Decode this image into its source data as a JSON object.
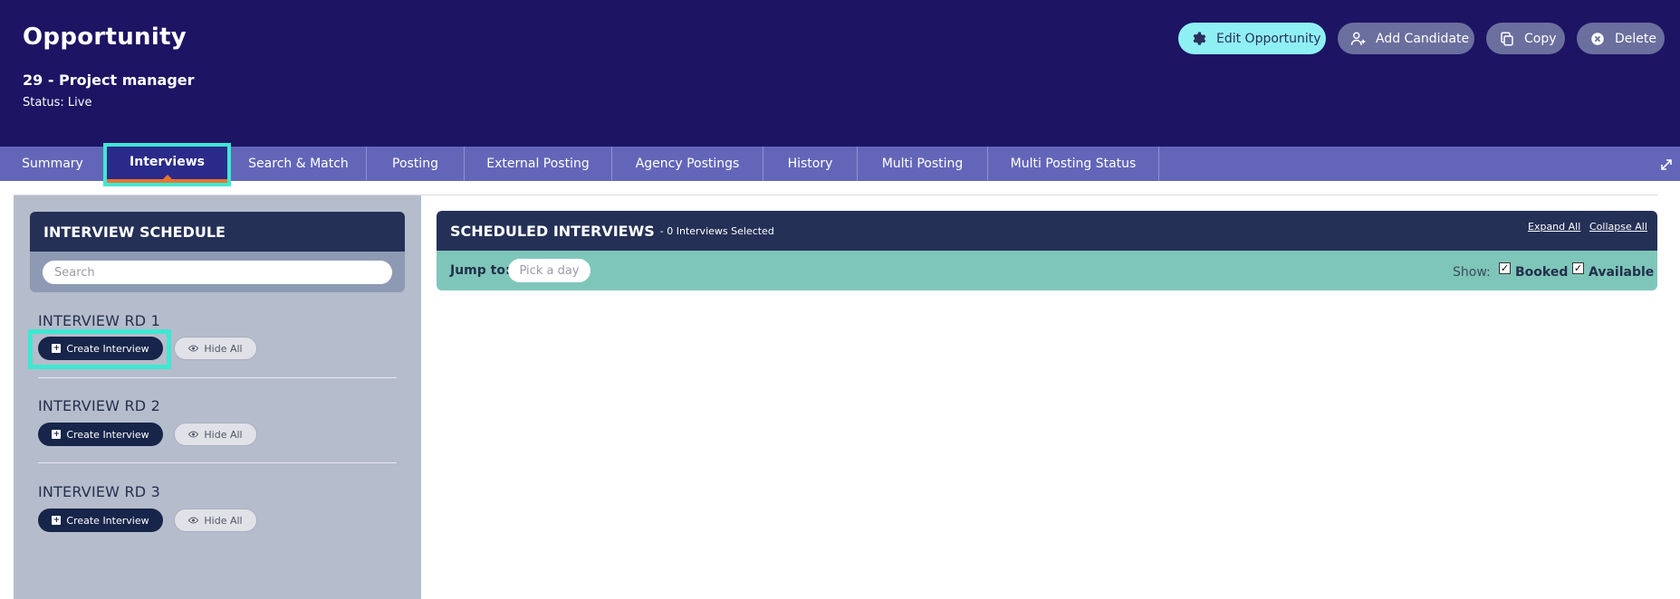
{
  "header": {
    "title": "Opportunity",
    "subtitle": "29 - Project manager",
    "status": "Status: Live",
    "buttons": {
      "edit": "Edit Opportunity",
      "add_candidate": "Add Candidate",
      "copy": "Copy",
      "delete": "Delete"
    }
  },
  "tabs": [
    {
      "label": "Summary"
    },
    {
      "label": "Interviews",
      "active": true
    },
    {
      "label": "Search & Match"
    },
    {
      "label": "Posting"
    },
    {
      "label": "External Posting"
    },
    {
      "label": "Agency Postings"
    },
    {
      "label": "History"
    },
    {
      "label": "Multi Posting"
    },
    {
      "label": "Multi Posting Status"
    }
  ],
  "schedule": {
    "title": "INTERVIEW SCHEDULE",
    "search_placeholder": "Search",
    "rounds": [
      {
        "title": "INTERVIEW RD 1",
        "create_label": "Create Interview",
        "hide_label": "Hide All"
      },
      {
        "title": "INTERVIEW RD 2",
        "create_label": "Create Interview",
        "hide_label": "Hide All"
      },
      {
        "title": "INTERVIEW RD 3",
        "create_label": "Create Interview",
        "hide_label": "Hide All"
      }
    ]
  },
  "scheduled": {
    "title": "SCHEDULED INTERVIEWS",
    "selected_text": "- 0 Interviews Selected",
    "expand_all": "Expand All",
    "collapse_all": "Collapse All",
    "jump_label": "Jump to:",
    "jump_placeholder": "Pick a day",
    "show_label": "Show:",
    "filters": [
      {
        "label": "Booked",
        "checked": true
      },
      {
        "label": "Available",
        "checked": true
      }
    ]
  },
  "colors": {
    "header_bg": "#1d1464",
    "tab_bg": "#6366b8",
    "active_tab_bg": "#2a2a8a",
    "highlight": "#3ee8d2",
    "active_underline": "#e8742d",
    "panel_dark": "#243056",
    "jump_bar": "#7fc6ba"
  },
  "icons": [
    "gear-icon",
    "add-user-icon",
    "copy-icon",
    "delete-icon",
    "expand-icon",
    "plus-icon",
    "eye-icon",
    "check-icon"
  ]
}
